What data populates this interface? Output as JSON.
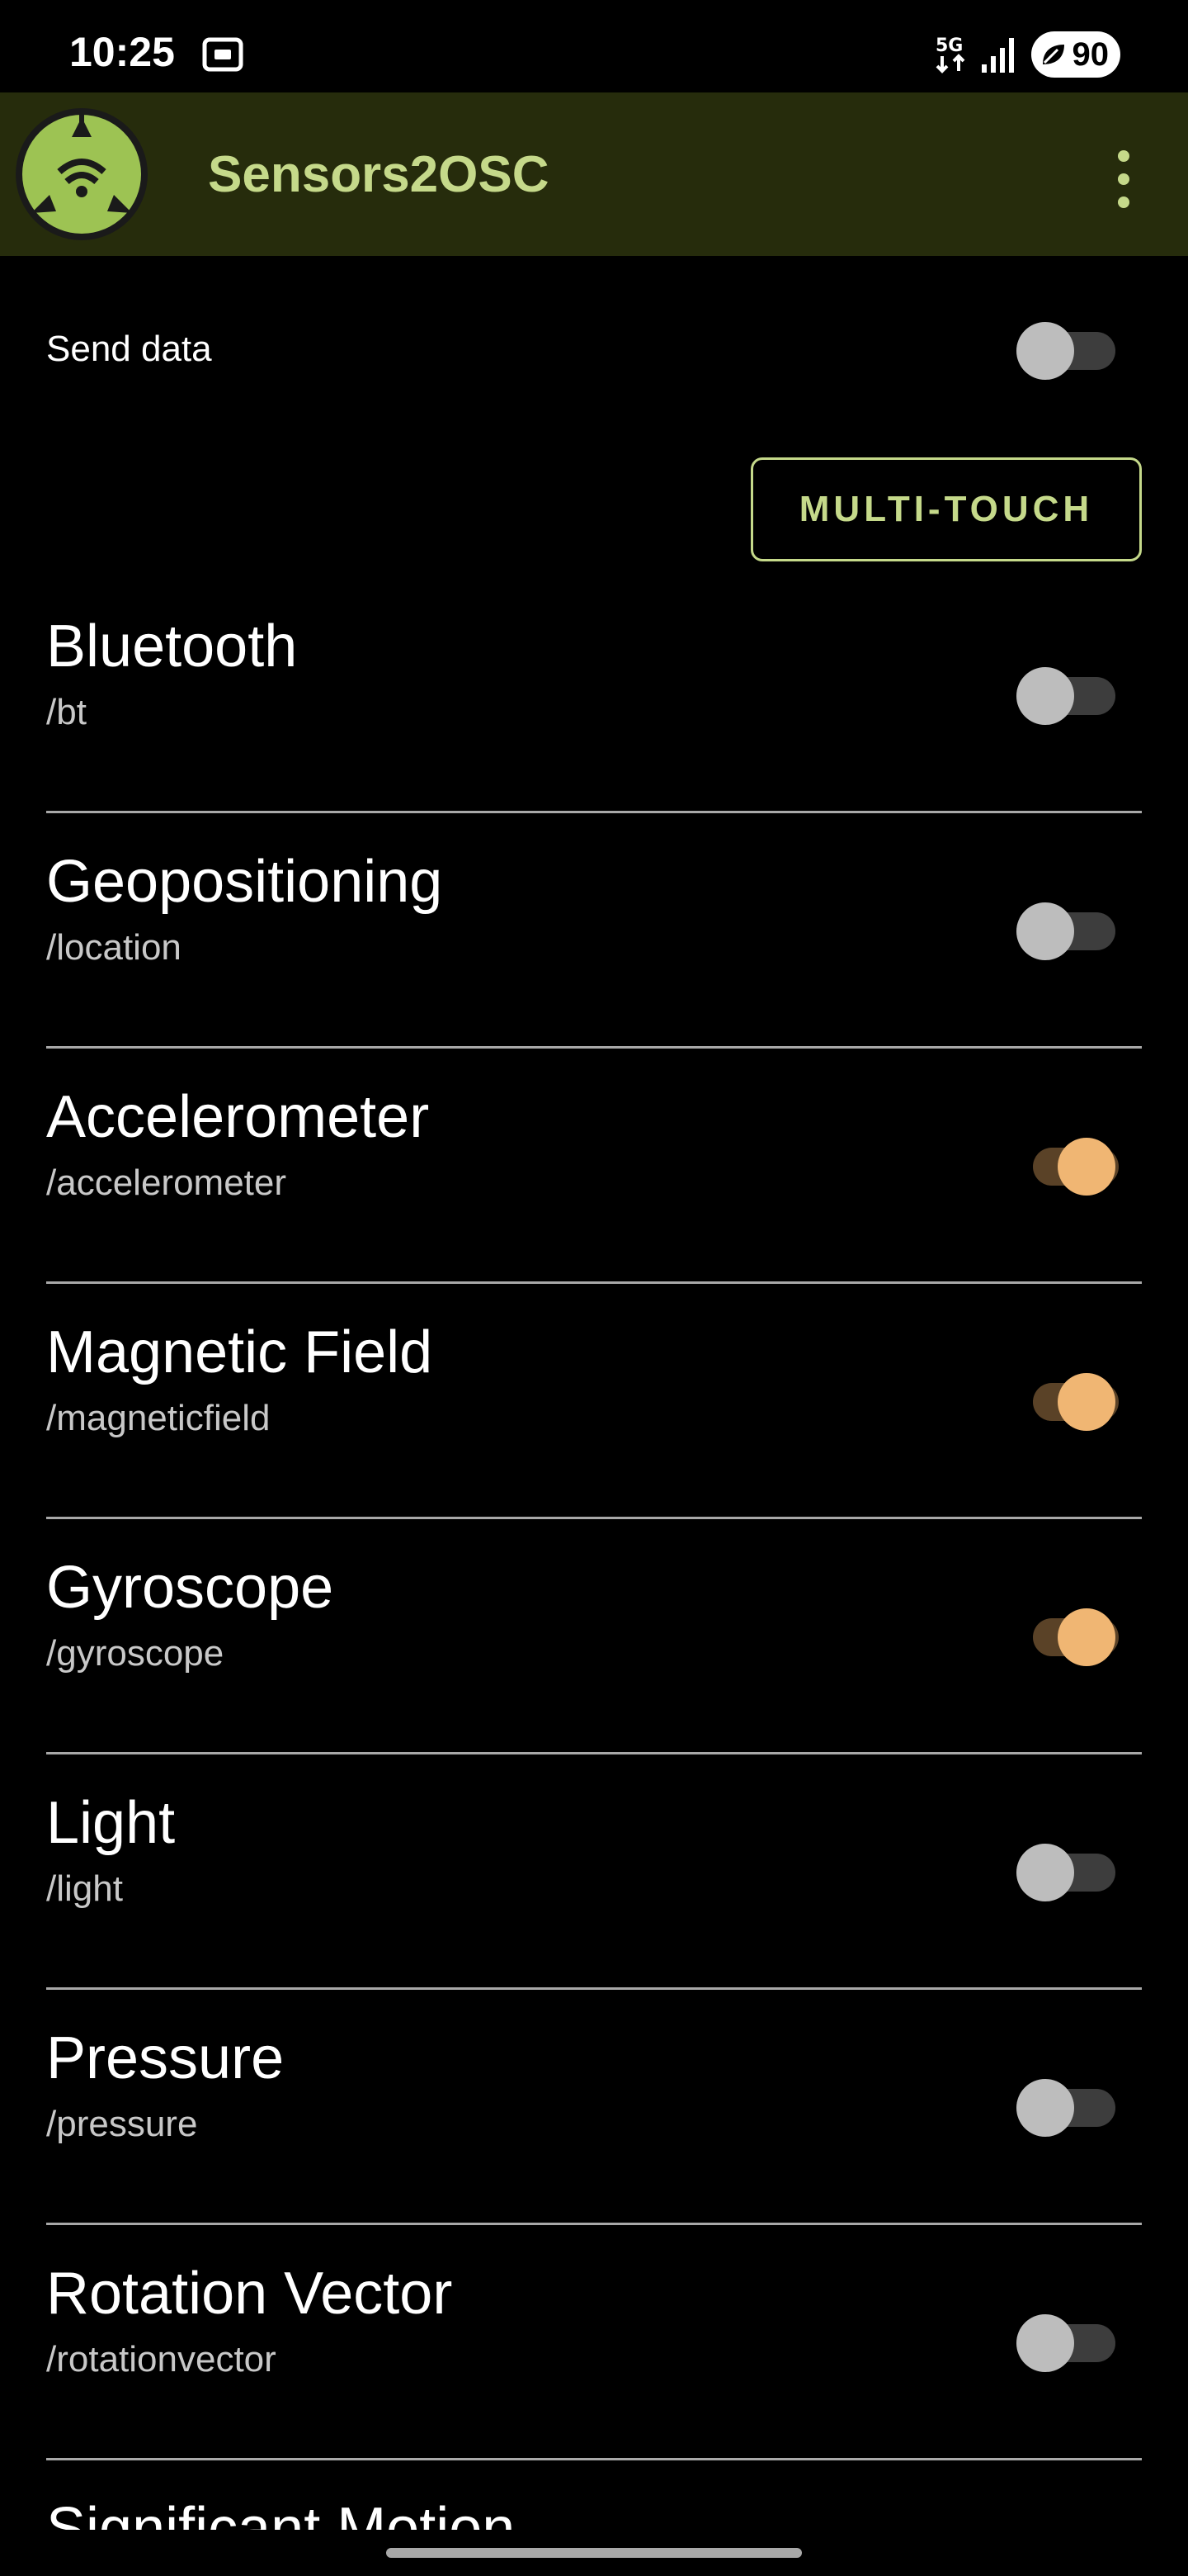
{
  "status_bar": {
    "time": "10:25",
    "network": "5G",
    "battery": "90",
    "icons": [
      "screen-record-icon",
      "5g-icon",
      "signal-icon",
      "battery-saver-icon"
    ]
  },
  "app_bar": {
    "title": "Sensors2OSC",
    "logo_icon": "sensors2osc-logo-icon",
    "menu_icon": "overflow-menu-icon"
  },
  "send_data": {
    "label": "Send data",
    "enabled": false
  },
  "multitouch": {
    "label": "MULTI-TOUCH"
  },
  "sensors": [
    {
      "name": "Bluetooth",
      "path": "/bt",
      "enabled": false
    },
    {
      "name": "Geopositioning",
      "path": "/location",
      "enabled": false
    },
    {
      "name": "Accelerometer",
      "path": "/accelerometer",
      "enabled": true
    },
    {
      "name": "Magnetic Field",
      "path": "/magneticfield",
      "enabled": true
    },
    {
      "name": "Gyroscope",
      "path": "/gyroscope",
      "enabled": true
    },
    {
      "name": "Light",
      "path": "/light",
      "enabled": false
    },
    {
      "name": "Pressure",
      "path": "/pressure",
      "enabled": false
    },
    {
      "name": "Rotation Vector",
      "path": "/rotationvector",
      "enabled": false
    },
    {
      "name": "Significant Motion",
      "path": "",
      "enabled": false
    }
  ],
  "colors": {
    "accent": "#c5d98a",
    "app_bar_bg": "#262c0c",
    "switch_on_thumb": "#f0b673",
    "switch_on_track": "#5a4227"
  }
}
